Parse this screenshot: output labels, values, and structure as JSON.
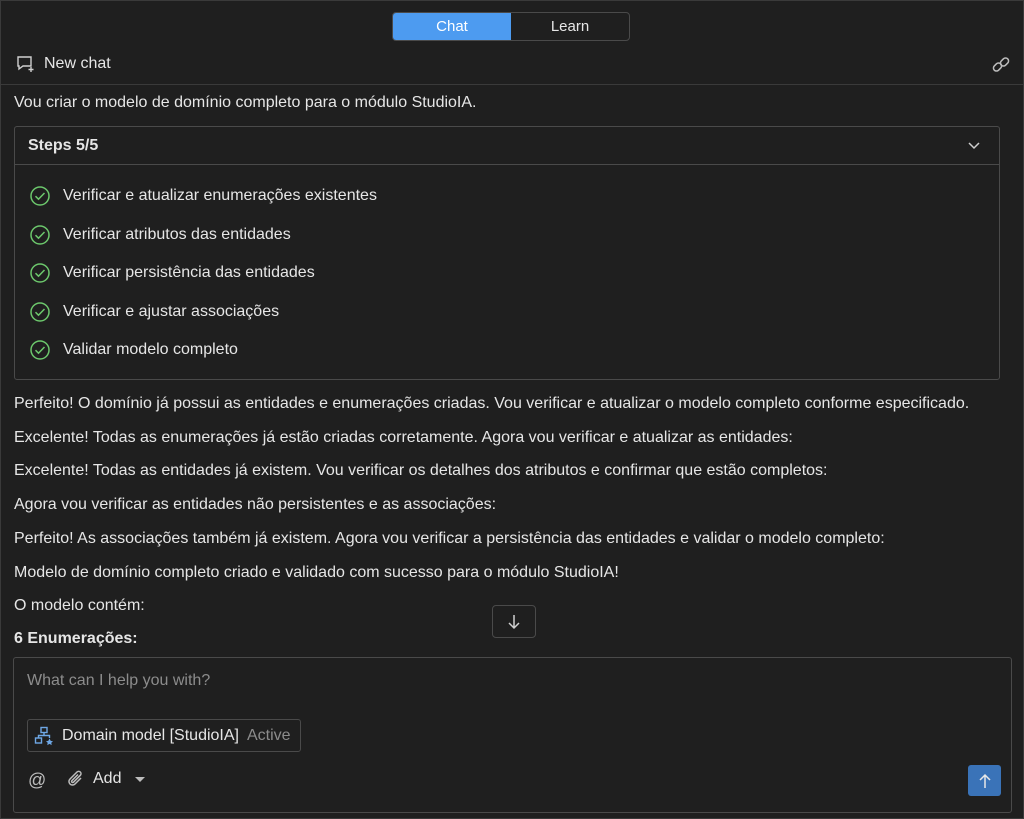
{
  "tabs": [
    {
      "label": "Chat",
      "active": true
    },
    {
      "label": "Learn",
      "active": false
    }
  ],
  "toolbar": {
    "new_chat_label": "New chat",
    "new_chat_icon": "new-chat-icon",
    "link_icon": "link-icon"
  },
  "conversation": {
    "intro": "Vou criar o modelo de domínio completo para o módulo StudioIA.",
    "steps": {
      "title": "Steps 5/5",
      "items": [
        {
          "label": "Verificar e atualizar enumerações existentes",
          "done": true
        },
        {
          "label": "Verificar atributos das entidades",
          "done": true
        },
        {
          "label": "Verificar persistência das entidades",
          "done": true
        },
        {
          "label": "Verificar e ajustar associações",
          "done": true
        },
        {
          "label": "Validar modelo completo",
          "done": true
        }
      ]
    },
    "messages": [
      "Perfeito! O domínio já possui as entidades e enumerações criadas. Vou verificar e atualizar o modelo completo conforme especificado.",
      "Excelente! Todas as enumerações já estão criadas corretamente. Agora vou verificar e atualizar as entidades:",
      "Excelente! Todas as entidades já existem. Vou verificar os detalhes dos atributos e confirmar que estão completos:",
      "Agora vou verificar as entidades não persistentes e as associações:",
      "Perfeito! As associações também já existem. Agora vou verificar a persistência das entidades e validar o modelo completo:",
      "Modelo de domínio completo criado e validado com sucesso para o módulo StudioIA!",
      "O modelo contém:"
    ],
    "section_heading": "6 Enumerações:"
  },
  "composer": {
    "placeholder": "What can I help you with?",
    "context_label": "Domain model [StudioIA]",
    "context_status": "Active",
    "add_label": "Add"
  },
  "colors": {
    "accent": "#4d9bf0",
    "check": "#6cc76c",
    "send": "#3a73b8"
  }
}
